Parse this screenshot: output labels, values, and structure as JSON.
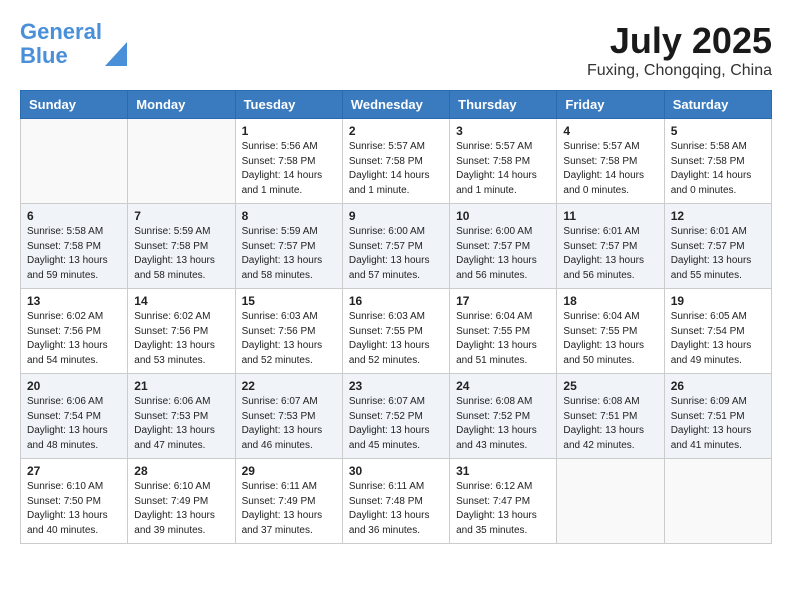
{
  "header": {
    "logo_line1": "General",
    "logo_line2": "Blue",
    "month_title": "July 2025",
    "location": "Fuxing, Chongqing, China"
  },
  "weekdays": [
    "Sunday",
    "Monday",
    "Tuesday",
    "Wednesday",
    "Thursday",
    "Friday",
    "Saturday"
  ],
  "weeks": [
    [
      {
        "day": "",
        "sunrise": "",
        "sunset": "",
        "daylight": ""
      },
      {
        "day": "",
        "sunrise": "",
        "sunset": "",
        "daylight": ""
      },
      {
        "day": "1",
        "sunrise": "Sunrise: 5:56 AM",
        "sunset": "Sunset: 7:58 PM",
        "daylight": "Daylight: 14 hours and 1 minute."
      },
      {
        "day": "2",
        "sunrise": "Sunrise: 5:57 AM",
        "sunset": "Sunset: 7:58 PM",
        "daylight": "Daylight: 14 hours and 1 minute."
      },
      {
        "day": "3",
        "sunrise": "Sunrise: 5:57 AM",
        "sunset": "Sunset: 7:58 PM",
        "daylight": "Daylight: 14 hours and 1 minute."
      },
      {
        "day": "4",
        "sunrise": "Sunrise: 5:57 AM",
        "sunset": "Sunset: 7:58 PM",
        "daylight": "Daylight: 14 hours and 0 minutes."
      },
      {
        "day": "5",
        "sunrise": "Sunrise: 5:58 AM",
        "sunset": "Sunset: 7:58 PM",
        "daylight": "Daylight: 14 hours and 0 minutes."
      }
    ],
    [
      {
        "day": "6",
        "sunrise": "Sunrise: 5:58 AM",
        "sunset": "Sunset: 7:58 PM",
        "daylight": "Daylight: 13 hours and 59 minutes."
      },
      {
        "day": "7",
        "sunrise": "Sunrise: 5:59 AM",
        "sunset": "Sunset: 7:58 PM",
        "daylight": "Daylight: 13 hours and 58 minutes."
      },
      {
        "day": "8",
        "sunrise": "Sunrise: 5:59 AM",
        "sunset": "Sunset: 7:57 PM",
        "daylight": "Daylight: 13 hours and 58 minutes."
      },
      {
        "day": "9",
        "sunrise": "Sunrise: 6:00 AM",
        "sunset": "Sunset: 7:57 PM",
        "daylight": "Daylight: 13 hours and 57 minutes."
      },
      {
        "day": "10",
        "sunrise": "Sunrise: 6:00 AM",
        "sunset": "Sunset: 7:57 PM",
        "daylight": "Daylight: 13 hours and 56 minutes."
      },
      {
        "day": "11",
        "sunrise": "Sunrise: 6:01 AM",
        "sunset": "Sunset: 7:57 PM",
        "daylight": "Daylight: 13 hours and 56 minutes."
      },
      {
        "day": "12",
        "sunrise": "Sunrise: 6:01 AM",
        "sunset": "Sunset: 7:57 PM",
        "daylight": "Daylight: 13 hours and 55 minutes."
      }
    ],
    [
      {
        "day": "13",
        "sunrise": "Sunrise: 6:02 AM",
        "sunset": "Sunset: 7:56 PM",
        "daylight": "Daylight: 13 hours and 54 minutes."
      },
      {
        "day": "14",
        "sunrise": "Sunrise: 6:02 AM",
        "sunset": "Sunset: 7:56 PM",
        "daylight": "Daylight: 13 hours and 53 minutes."
      },
      {
        "day": "15",
        "sunrise": "Sunrise: 6:03 AM",
        "sunset": "Sunset: 7:56 PM",
        "daylight": "Daylight: 13 hours and 52 minutes."
      },
      {
        "day": "16",
        "sunrise": "Sunrise: 6:03 AM",
        "sunset": "Sunset: 7:55 PM",
        "daylight": "Daylight: 13 hours and 52 minutes."
      },
      {
        "day": "17",
        "sunrise": "Sunrise: 6:04 AM",
        "sunset": "Sunset: 7:55 PM",
        "daylight": "Daylight: 13 hours and 51 minutes."
      },
      {
        "day": "18",
        "sunrise": "Sunrise: 6:04 AM",
        "sunset": "Sunset: 7:55 PM",
        "daylight": "Daylight: 13 hours and 50 minutes."
      },
      {
        "day": "19",
        "sunrise": "Sunrise: 6:05 AM",
        "sunset": "Sunset: 7:54 PM",
        "daylight": "Daylight: 13 hours and 49 minutes."
      }
    ],
    [
      {
        "day": "20",
        "sunrise": "Sunrise: 6:06 AM",
        "sunset": "Sunset: 7:54 PM",
        "daylight": "Daylight: 13 hours and 48 minutes."
      },
      {
        "day": "21",
        "sunrise": "Sunrise: 6:06 AM",
        "sunset": "Sunset: 7:53 PM",
        "daylight": "Daylight: 13 hours and 47 minutes."
      },
      {
        "day": "22",
        "sunrise": "Sunrise: 6:07 AM",
        "sunset": "Sunset: 7:53 PM",
        "daylight": "Daylight: 13 hours and 46 minutes."
      },
      {
        "day": "23",
        "sunrise": "Sunrise: 6:07 AM",
        "sunset": "Sunset: 7:52 PM",
        "daylight": "Daylight: 13 hours and 45 minutes."
      },
      {
        "day": "24",
        "sunrise": "Sunrise: 6:08 AM",
        "sunset": "Sunset: 7:52 PM",
        "daylight": "Daylight: 13 hours and 43 minutes."
      },
      {
        "day": "25",
        "sunrise": "Sunrise: 6:08 AM",
        "sunset": "Sunset: 7:51 PM",
        "daylight": "Daylight: 13 hours and 42 minutes."
      },
      {
        "day": "26",
        "sunrise": "Sunrise: 6:09 AM",
        "sunset": "Sunset: 7:51 PM",
        "daylight": "Daylight: 13 hours and 41 minutes."
      }
    ],
    [
      {
        "day": "27",
        "sunrise": "Sunrise: 6:10 AM",
        "sunset": "Sunset: 7:50 PM",
        "daylight": "Daylight: 13 hours and 40 minutes."
      },
      {
        "day": "28",
        "sunrise": "Sunrise: 6:10 AM",
        "sunset": "Sunset: 7:49 PM",
        "daylight": "Daylight: 13 hours and 39 minutes."
      },
      {
        "day": "29",
        "sunrise": "Sunrise: 6:11 AM",
        "sunset": "Sunset: 7:49 PM",
        "daylight": "Daylight: 13 hours and 37 minutes."
      },
      {
        "day": "30",
        "sunrise": "Sunrise: 6:11 AM",
        "sunset": "Sunset: 7:48 PM",
        "daylight": "Daylight: 13 hours and 36 minutes."
      },
      {
        "day": "31",
        "sunrise": "Sunrise: 6:12 AM",
        "sunset": "Sunset: 7:47 PM",
        "daylight": "Daylight: 13 hours and 35 minutes."
      },
      {
        "day": "",
        "sunrise": "",
        "sunset": "",
        "daylight": ""
      },
      {
        "day": "",
        "sunrise": "",
        "sunset": "",
        "daylight": ""
      }
    ]
  ]
}
